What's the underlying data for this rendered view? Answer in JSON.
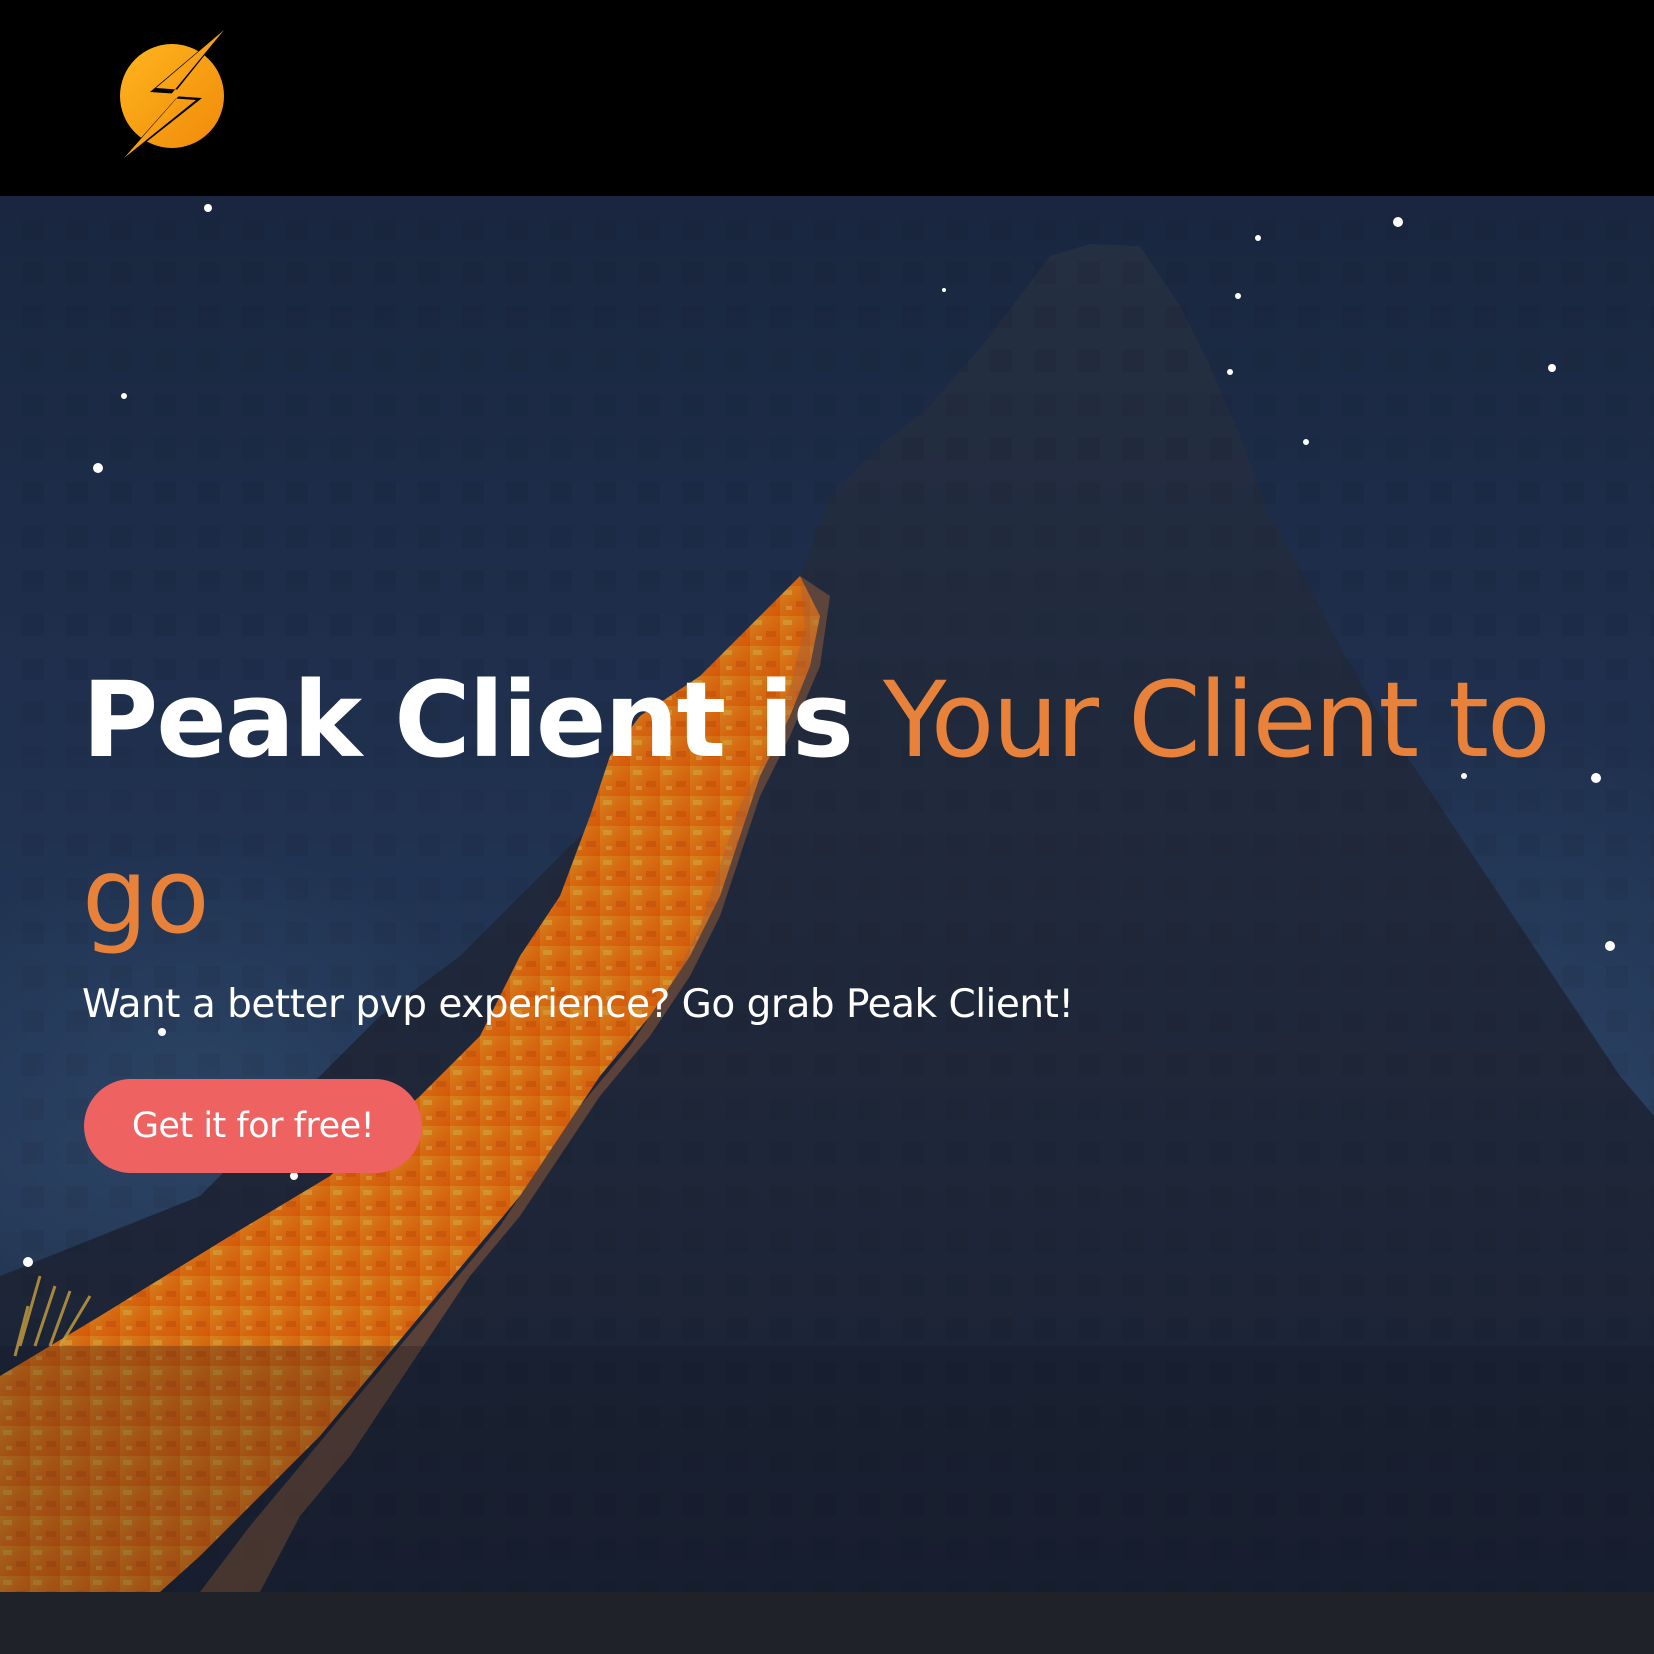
{
  "header": {
    "logo_icon": "lightning-bolt-logo",
    "brand_color": "#f5a623"
  },
  "hero": {
    "headline_white": "Peak Client is",
    "headline_orange": "Your Client to go",
    "subtext": "Want a better pvp experience? Go grab Peak Client!",
    "cta_label": "Get it for free!",
    "accent_color": "#e8823a",
    "cta_color": "#ef6262",
    "background_description_icon": "lava-mountain-night-scene"
  }
}
